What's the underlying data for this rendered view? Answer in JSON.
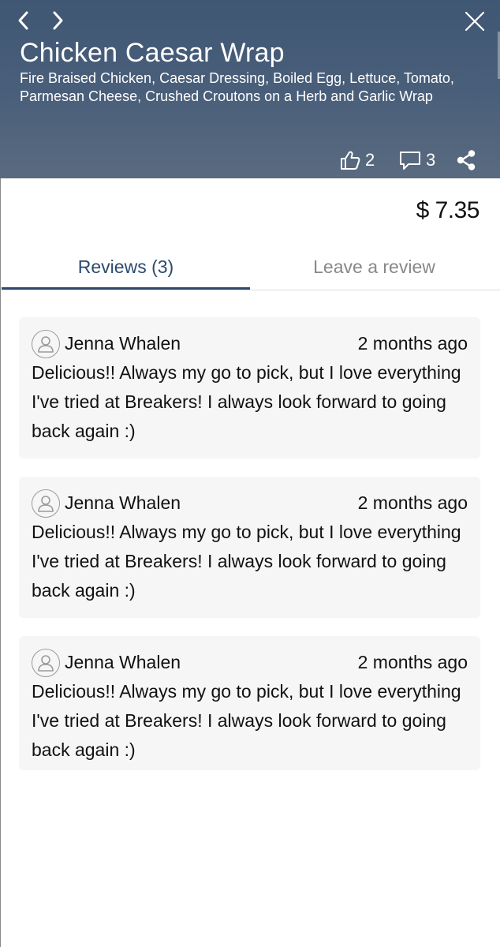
{
  "header": {
    "title": "Chicken Caesar Wrap",
    "description": "Fire Braised Chicken,  Caesar Dressing, Boiled Egg, Lettuce, Tomato, Parmesan Cheese, Crushed Croutons on a Herb and Garlic Wrap",
    "likes": "2",
    "comments": "3",
    "icons": {
      "back": "chevron-left-icon",
      "forward": "chevron-right-icon",
      "close": "close-icon",
      "like": "thumbs-up-icon",
      "comment": "comment-icon",
      "share": "share-icon"
    }
  },
  "price": "$ 7.35",
  "tabs": [
    {
      "label": "Reviews (3)",
      "active": true
    },
    {
      "label": "Leave a review",
      "active": false
    }
  ],
  "reviews": [
    {
      "name": "Jenna Whalen",
      "time": "2 months ago",
      "text": "Delicious!! Always my go to pick, but I love everything I've tried at Breakers! I always look forward to going back again :)"
    },
    {
      "name": "Jenna Whalen",
      "time": "2 months ago",
      "text": "Delicious!! Always my go to pick, but I love everything I've tried at Breakers! I always look forward to going back again :)"
    },
    {
      "name": "Jenna Whalen",
      "time": "2 months ago",
      "text": "Delicious!! Always my go to pick, but I love everything I've tried at Breakers! I always look forward to going back again :)"
    }
  ],
  "colors": {
    "header_bg": "#46607f",
    "active_tab": "#2c4a6e",
    "inactive_tab": "#888888",
    "review_bg": "#f6f6f6"
  }
}
